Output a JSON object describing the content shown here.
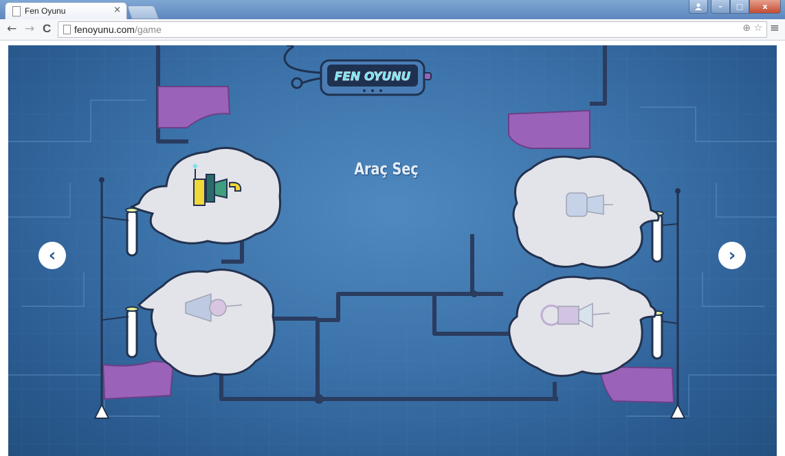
{
  "browser": {
    "tab_title": "Fen Oyunu",
    "tab_close": "×",
    "url_host": "fenoyunu.com",
    "url_path": "/game",
    "back_icon": "←",
    "forward_icon": "→",
    "reload_icon": "C",
    "zoom_icon": "⊕",
    "star_icon": "☆",
    "menu_icon": "≡",
    "win_minimize": "–",
    "win_maximize": "□",
    "win_close": "x"
  },
  "game": {
    "logo_text": "FEN OYUNU",
    "heading": "Araç Seç",
    "prev_arrow": "‹",
    "next_arrow": "›",
    "vehicles": [
      "vehicle-1-unlocked",
      "vehicle-2-locked",
      "vehicle-3-locked",
      "vehicle-4-locked"
    ]
  },
  "colors": {
    "background": "#3b72a9",
    "flag": "#9a62b8",
    "cloud": "#e3e3ea",
    "pipe": "#2a3c5f"
  }
}
